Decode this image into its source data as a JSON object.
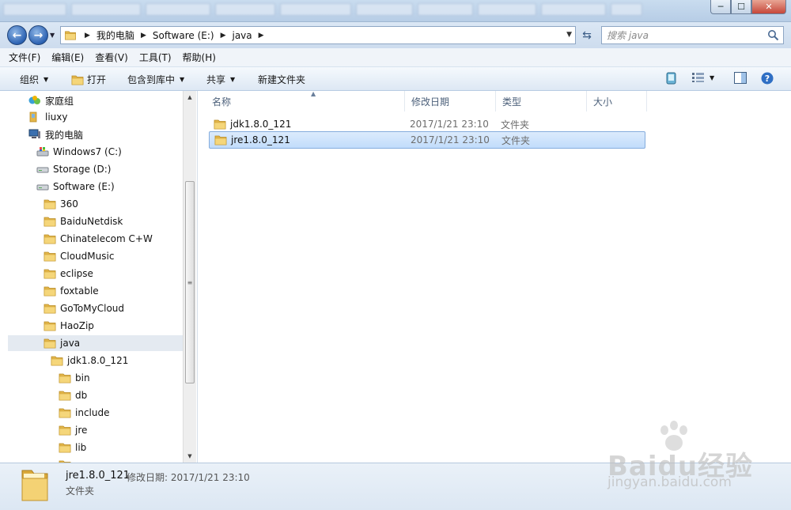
{
  "window": {
    "minimize": "─",
    "maximize": "☐",
    "close": "✕"
  },
  "address": {
    "crumbs": [
      "我的电脑",
      "Software (E:)",
      "java"
    ],
    "search_placeholder": "搜索 java"
  },
  "menu": [
    "文件(F)",
    "编辑(E)",
    "查看(V)",
    "工具(T)",
    "帮助(H)"
  ],
  "toolbar": {
    "organize": "组织",
    "open": "打开",
    "include_library": "包含到库中",
    "share": "共享",
    "new_folder": "新建文件夹"
  },
  "nav": {
    "items": [
      {
        "label": "家庭组",
        "icon": "homegroup-icon"
      },
      {
        "label": "liuxy",
        "icon": "user-folder-icon"
      },
      {
        "label": "我的电脑",
        "icon": "computer-icon"
      },
      {
        "label": "Windows7 (C:)",
        "icon": "system-drive-icon"
      },
      {
        "label": "Storage (D:)",
        "icon": "drive-icon"
      },
      {
        "label": "Software (E:)",
        "icon": "drive-icon"
      },
      {
        "label": "360",
        "icon": "folder-icon"
      },
      {
        "label": "BaiduNetdisk",
        "icon": "folder-icon"
      },
      {
        "label": "Chinatelecom C+W",
        "icon": "folder-icon"
      },
      {
        "label": "CloudMusic",
        "icon": "folder-icon"
      },
      {
        "label": "eclipse",
        "icon": "folder-icon"
      },
      {
        "label": "foxtable",
        "icon": "folder-icon"
      },
      {
        "label": "GoToMyCloud",
        "icon": "folder-icon"
      },
      {
        "label": "HaoZip",
        "icon": "folder-icon"
      },
      {
        "label": "java",
        "icon": "folder-icon"
      },
      {
        "label": "jdk1.8.0_121",
        "icon": "folder-icon"
      },
      {
        "label": "bin",
        "icon": "folder-icon"
      },
      {
        "label": "db",
        "icon": "folder-icon"
      },
      {
        "label": "include",
        "icon": "folder-icon"
      },
      {
        "label": "jre",
        "icon": "folder-icon"
      },
      {
        "label": "lib",
        "icon": "folder-icon"
      }
    ]
  },
  "columns": [
    "名称",
    "修改日期",
    "类型",
    "大小"
  ],
  "files": [
    {
      "name": "jdk1.8.0_121",
      "date": "2017/1/21 23:10",
      "type": "文件夹"
    },
    {
      "name": "jre1.8.0_121",
      "date": "2017/1/21 23:10",
      "type": "文件夹"
    }
  ],
  "details": {
    "name": "jre1.8.0_121",
    "meta": "修改日期: 2017/1/21 23:10",
    "type": "文件夹"
  },
  "watermark": {
    "brand": "Baidu经验",
    "url": "jingyan.baidu.com"
  },
  "colors": {
    "selection": "#c1dcfb",
    "selection_border": "#84acdd",
    "folder": "#e8c458"
  }
}
